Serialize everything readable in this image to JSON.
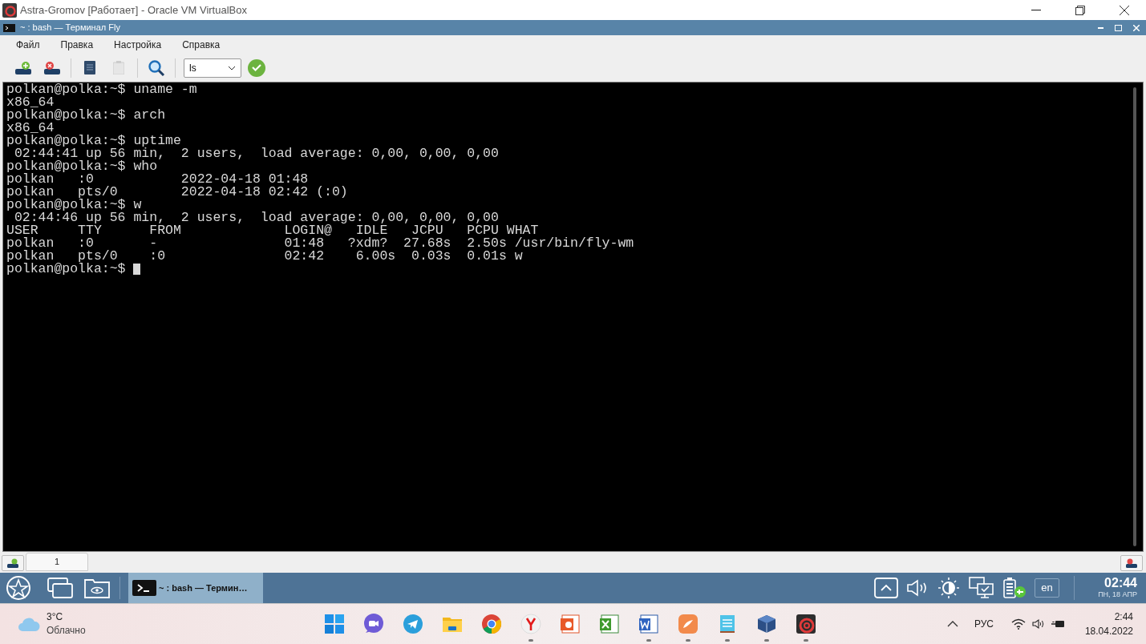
{
  "host_window": {
    "title": "Astra-Gromov [Работает] - Oracle VM VirtualBox"
  },
  "terminal_window": {
    "title": "~ : bash — Терминал Fly"
  },
  "menu": [
    "Файл",
    "Правка",
    "Настройка",
    "Справка"
  ],
  "toolbar": {
    "command_value": "ls"
  },
  "terminal": {
    "lines": [
      "polkan@polka:~$ uname -m",
      "x86_64",
      "polkan@polka:~$ arch",
      "x86_64",
      "polkan@polka:~$ uptime",
      " 02:44:41 up 56 min,  2 users,  load average: 0,00, 0,00, 0,00",
      "polkan@polka:~$ who",
      "polkan   :0           2022-04-18 01:48",
      "polkan   pts/0        2022-04-18 02:42 (:0)",
      "polkan@polka:~$ w",
      " 02:44:46 up 56 min,  2 users,  load average: 0,00, 0,00, 0,00",
      "USER     TTY      FROM             LOGIN@   IDLE   JCPU   PCPU WHAT",
      "polkan   :0       -                01:48   ?xdm?  27.68s  2.50s /usr/bin/fly-wm",
      "polkan   pts/0    :0               02:42    6.00s  0.03s  0.01s w",
      "polkan@polka:~$ "
    ]
  },
  "session_tabs": [
    {
      "label": "1",
      "selected": true
    }
  ],
  "fly_panel": {
    "task": {
      "label": "~ : bash — Термин…",
      "selected": true
    },
    "language": "en",
    "time": "02:44",
    "date": "ПН, 18 АПР"
  },
  "win_taskbar": {
    "weather": {
      "temperature": "3°C",
      "condition": "Облачно"
    },
    "apps": [
      {
        "kind": "start",
        "running": false
      },
      {
        "kind": "meet",
        "running": false
      },
      {
        "kind": "telegram",
        "running": false
      },
      {
        "kind": "folder",
        "running": false
      },
      {
        "kind": "chrome",
        "running": false
      },
      {
        "kind": "yandex",
        "running": true
      },
      {
        "kind": "powerpoint",
        "running": false
      },
      {
        "kind": "excel",
        "running": false
      },
      {
        "kind": "word",
        "running": true
      },
      {
        "kind": "vpn",
        "running": true
      },
      {
        "kind": "notepad",
        "running": true
      },
      {
        "kind": "virtualbox",
        "running": true
      },
      {
        "kind": "astra",
        "running": true
      }
    ],
    "language": "РУС",
    "time": "2:44",
    "date": "18.04.2022"
  }
}
